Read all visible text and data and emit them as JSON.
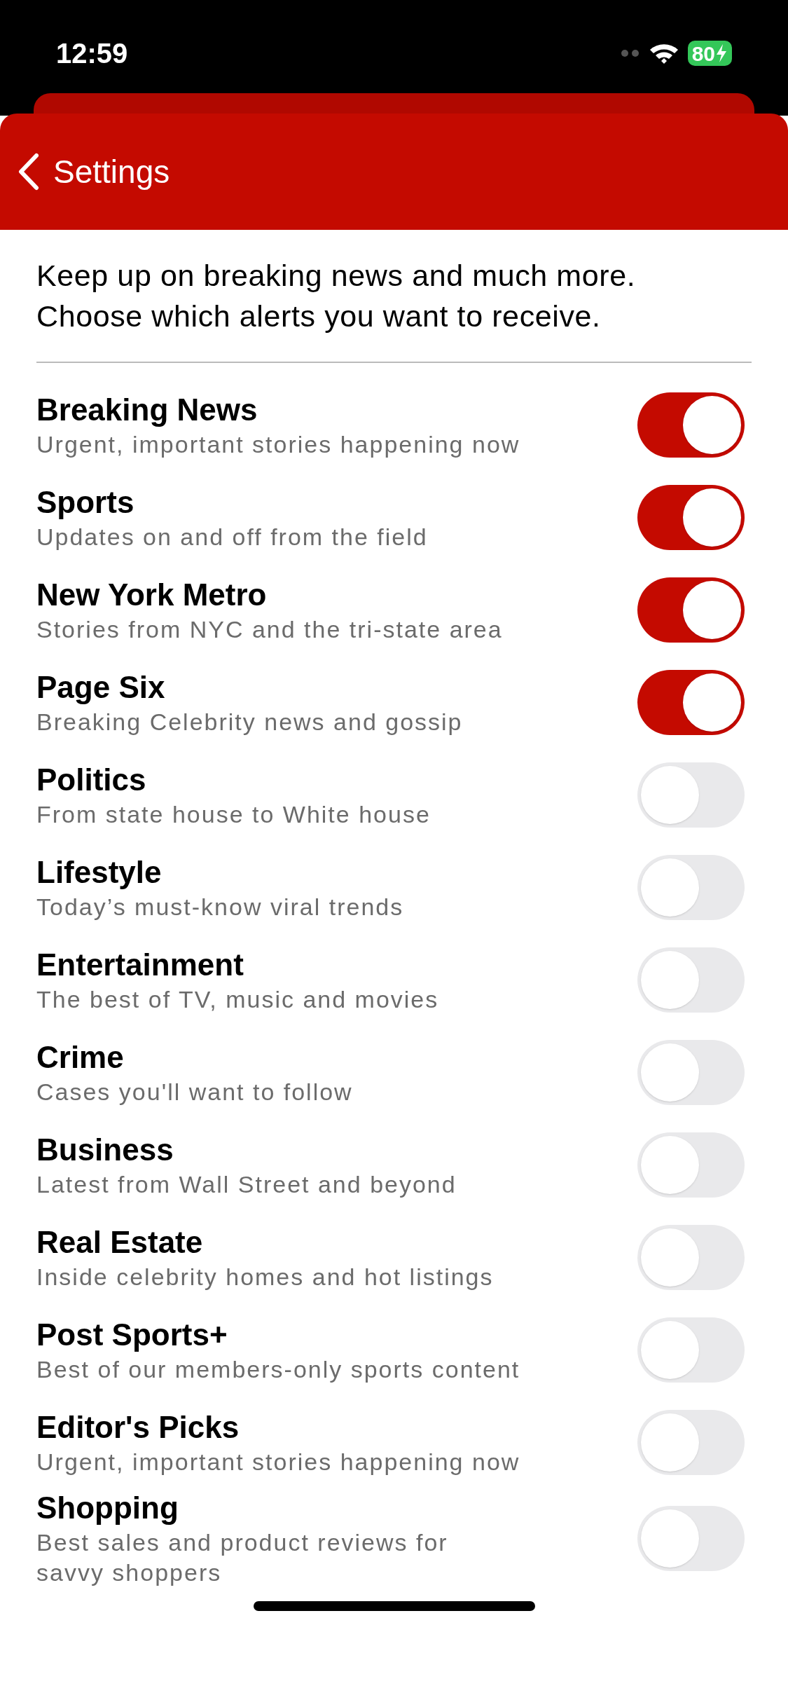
{
  "status_bar": {
    "time": "12:59",
    "battery": "80"
  },
  "header": {
    "title": "Settings"
  },
  "intro": "Keep up on breaking news and much more. Choose which alerts you want to receive.",
  "alerts": [
    {
      "title": "Breaking News",
      "subtitle": "Urgent, important stories happening now",
      "on": true
    },
    {
      "title": "Sports",
      "subtitle": "Updates on and off from the field",
      "on": true
    },
    {
      "title": "New York Metro",
      "subtitle": "Stories from NYC and the tri-state area",
      "on": true
    },
    {
      "title": "Page Six",
      "subtitle": "Breaking Celebrity news and gossip",
      "on": true
    },
    {
      "title": "Politics",
      "subtitle": "From state house to White house",
      "on": false
    },
    {
      "title": "Lifestyle",
      "subtitle": "Today’s must-know viral trends",
      "on": false
    },
    {
      "title": "Entertainment",
      "subtitle": "The best of TV, music and movies",
      "on": false
    },
    {
      "title": "Crime",
      "subtitle": "Cases you'll want to follow",
      "on": false
    },
    {
      "title": "Business",
      "subtitle": "Latest from Wall Street and beyond",
      "on": false
    },
    {
      "title": "Real Estate",
      "subtitle": "Inside celebrity homes and hot listings",
      "on": false
    },
    {
      "title": "Post Sports+",
      "subtitle": "Best of our members-only sports content",
      "on": false
    },
    {
      "title": "Editor's Picks",
      "subtitle": "Urgent, important stories happening now",
      "on": false
    },
    {
      "title": "Shopping",
      "subtitle": "Best sales and product reviews for\nsavvy shoppers",
      "on": false
    }
  ]
}
